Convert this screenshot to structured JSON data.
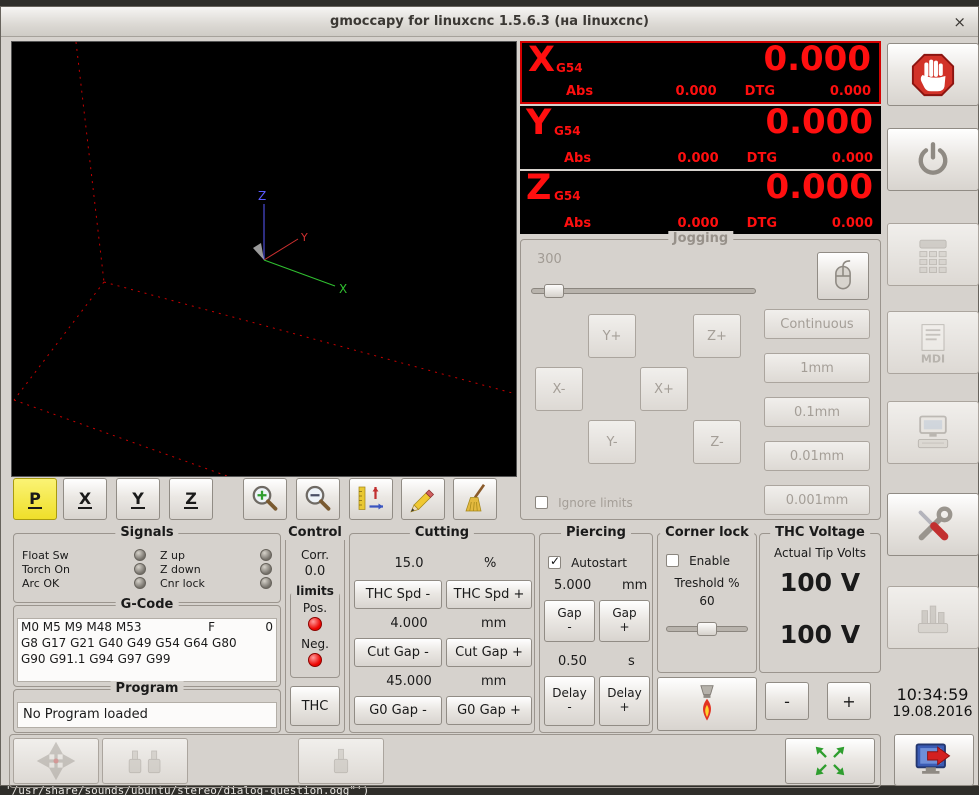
{
  "window": {
    "title": "gmoccapy for linuxcnc  1.5.6.3 (на linuxcnc)",
    "close_label": "×"
  },
  "terminal": {
    "bottom_line": "'/usr/share/sounds/ubuntu/stereo/dialog-question.ogg\"')"
  },
  "preview": {
    "axis_labels": {
      "x": "X",
      "y": "Y",
      "z": "Z"
    },
    "toolbar": {
      "letter_p": "P",
      "letter_x": "X",
      "letter_y": "Y",
      "letter_z": "Z"
    }
  },
  "dro": {
    "axes": [
      {
        "letter": "X",
        "system": "G54",
        "value": "0.000",
        "abs_label": "Abs",
        "abs_value": "0.000",
        "dtg_label": "DTG",
        "dtg_value": "0.000"
      },
      {
        "letter": "Y",
        "system": "G54",
        "value": "0.000",
        "abs_label": "Abs",
        "abs_value": "0.000",
        "dtg_label": "DTG",
        "dtg_value": "0.000"
      },
      {
        "letter": "Z",
        "system": "G54",
        "value": "0.000",
        "abs_label": "Abs",
        "abs_value": "0.000",
        "dtg_label": "DTG",
        "dtg_value": "0.000"
      }
    ]
  },
  "jogging": {
    "title": "Jogging",
    "speed_value": "300",
    "jog_buttons": {
      "y_plus": "Y+",
      "z_plus": "Z+",
      "x_minus": "X-",
      "x_plus": "X+",
      "y_minus": "Y-",
      "z_minus": "Z-"
    },
    "increments": [
      "Continuous",
      "1mm",
      "0.1mm",
      "0.01mm",
      "0.001mm"
    ],
    "ignore_limits_label": "Ignore limits"
  },
  "signals": {
    "title": "Signals",
    "left": [
      "Float Sw",
      "Torch On",
      "Arc OK"
    ],
    "right": [
      "Z up",
      "Z down",
      "Cnr lock"
    ]
  },
  "gcode": {
    "title": "G-Code",
    "line1": "M0 M5 M9 M48 M53",
    "f_label": "F",
    "f_value": "0",
    "line2": "G8 G17 G21 G40 G49 G54 G64 G80",
    "line3": "G90 G91.1 G94 G97 G99"
  },
  "program": {
    "title": "Program",
    "status": "No Program loaded"
  },
  "control": {
    "title": "Control",
    "corr_label": "Corr.",
    "corr_value": "0.0",
    "limits_title": "limits",
    "pos_label": "Pos.",
    "neg_label": "Neg.",
    "thc_button": "THC"
  },
  "cutting": {
    "title": "Cutting",
    "feed_value": "15.0",
    "feed_unit": "%",
    "thc_spd_minus": "THC Spd -",
    "thc_spd_plus": "THC Spd +",
    "cut_gap_value": "4.000",
    "cut_gap_unit": "mm",
    "cut_gap_minus": "Cut Gap -",
    "cut_gap_plus": "Cut Gap +",
    "g0_gap_value": "45.000",
    "g0_gap_unit": "mm",
    "g0_gap_minus": "G0 Gap -",
    "g0_gap_plus": "G0 Gap +"
  },
  "piercing": {
    "title": "Piercing",
    "autostart_label": "Autostart",
    "gap_value": "5.000",
    "gap_unit": "mm",
    "gap_minus": "Gap\n-",
    "gap_plus": "Gap\n+",
    "delay_value": "0.50",
    "delay_unit": "s",
    "delay_minus": "Delay\n-",
    "delay_plus": "Delay\n+"
  },
  "corner_lock": {
    "title": "Corner lock",
    "enable_label": "Enable",
    "threshold_label": "Treshold %",
    "threshold_value": "60"
  },
  "thc_voltage": {
    "title": "THC Voltage",
    "subtitle": "Actual Tip Volts",
    "value_top": "100 V",
    "value_bottom": "100 V",
    "minus_label": "-",
    "plus_label": "+"
  },
  "sidebar": {
    "mdi_label": "MDI"
  },
  "clock": {
    "time": "10:34:59",
    "date": "19.08.2016"
  },
  "colors": {
    "dro_red": "#ff0f0f",
    "dro_bg": "#000000",
    "led_red": "#ec0400",
    "led_off": "#75716a",
    "active_yellow": "#efdf2a",
    "window_bg": "#d6d2cd"
  },
  "icons": {
    "machine_stop": "stop-hand-icon",
    "machine_on": "power-icon",
    "keypad": "keypad-icon",
    "mdi": "mdi-document-icon",
    "tool_editor": "computer-icon",
    "settings": "wrench-screwdriver-icon",
    "tool_station": "tool-station-icon",
    "exit": "exit-monitor-icon",
    "zoom_in": "magnifier-plus-icon",
    "zoom_out": "magnifier-minus-icon",
    "dimensions": "caliper-icon",
    "edit": "pencil-icon",
    "clear": "broom-icon",
    "mouse_jog": "mouse-icon",
    "torch": "torch-flame-icon",
    "fullscreen": "expand-arrows-icon",
    "home_axes": "arrows-cross-icon",
    "touch_plate": "tool-clamp-icon"
  }
}
